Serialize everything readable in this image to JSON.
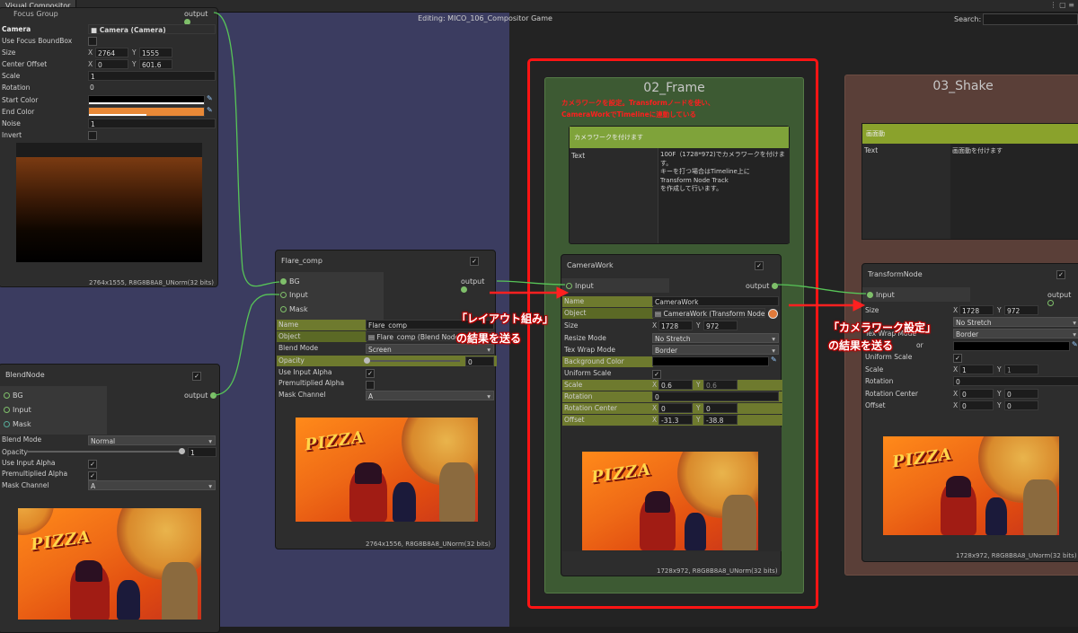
{
  "window": {
    "tab_title": "Visual Compositor",
    "editing_label": "Editing: MICO_106_Compositor Game",
    "search_label": "Search:",
    "search_value": ""
  },
  "focus_node": {
    "title": "Focus Group",
    "output_label": "output",
    "camera_label": "Camera",
    "camera_value": "Camera (Camera)",
    "use_focus_label": "Use Focus BoundBox",
    "size_label": "Size",
    "size_x": "2764",
    "size_y": "1555",
    "center_label": "Center Offset",
    "center_x": "0",
    "center_y": "601.6",
    "scale_label": "Scale",
    "scale_value": "1",
    "rotation_label": "Rotation",
    "rotation_value": "0",
    "start_color_label": "Start Color",
    "end_color_label": "End Color",
    "noise_label": "Noise",
    "noise_value": "1",
    "invert_label": "Invert",
    "footer": "2764x1555, R8G8B8A8_UNorm(32 bits)"
  },
  "blend_node": {
    "title": "BlendNode",
    "bg_label": "BG",
    "input_label": "Input",
    "mask_label": "Mask",
    "output_label": "output",
    "blend_mode_label": "Blend Mode",
    "blend_mode_value": "Normal",
    "opacity_label": "Opacity",
    "opacity_value": "1",
    "use_input_alpha_label": "Use Input Alpha",
    "premult_label": "Premultiplied Alpha",
    "mask_channel_label": "Mask Channel",
    "mask_channel_value": "A"
  },
  "flare_node": {
    "title": "Flare_comp",
    "bg_label": "BG",
    "input_label": "Input",
    "mask_label": "Mask",
    "output_label": "output",
    "name_label": "Name",
    "name_value": "Flare_comp",
    "object_label": "Object",
    "object_value": "Flare_comp (Blend Node P",
    "blend_mode_label": "Blend Mode",
    "blend_mode_value": "Screen",
    "opacity_label": "Opacity",
    "opacity_value": "0",
    "use_input_alpha_label": "Use Input Alpha",
    "premult_label": "Premultiplied Alpha",
    "mask_channel_label": "Mask Channel",
    "mask_channel_value": "A",
    "footer": "2764x1556, R8G8B8A8_UNorm(32 bits)"
  },
  "frame_group": {
    "title": "02_Frame",
    "annotation_line1": "カメラワークを設定。Transformノードを使い、",
    "annotation_line2": "CameraWorkでTimelineに連動している",
    "comment_title": "カメラワークを付けます",
    "comment_text_label": "Text",
    "comment_text_lines": [
      "100F（1728*972)でカメラワークを付けます。",
      "キーを打つ場合はTimeline上に",
      "Transform Node Track",
      "を作成して行います。"
    ]
  },
  "camerawork_node": {
    "title": "CameraWork",
    "input_label": "Input",
    "output_label": "output",
    "name_label": "Name",
    "name_value": "CameraWork",
    "object_label": "Object",
    "object_value": "CameraWork (Transform Node Pr",
    "size_label": "Size",
    "size_x": "1728",
    "size_y": "972",
    "resize_label": "Resize Mode",
    "resize_value": "No Stretch",
    "wrap_label": "Tex Wrap Mode",
    "wrap_value": "Border",
    "bgcolor_label": "Background Color",
    "uniform_label": "Uniform Scale",
    "scale_label": "Scale",
    "scale_x": "0.6",
    "scale_y": "0.6",
    "rotation_label": "Rotation",
    "rotation_value": "0",
    "rotcenter_label": "Rotation Center",
    "rotcenter_x": "0",
    "rotcenter_y": "0",
    "offset_label": "Offset",
    "offset_x": "-31.3",
    "offset_y": "-38.8",
    "footer": "1728x972, R8G8B8A8_UNorm(32 bits)"
  },
  "shake_group": {
    "title": "03_Shake",
    "comment_title": "画面動",
    "comment_text_label": "Text",
    "comment_text": "画面動を付けます"
  },
  "transform_node": {
    "title": "TransformNode",
    "input_label": "Input",
    "output_label": "output",
    "size_label": "Size",
    "size_x": "1728",
    "size_y": "972",
    "resize_value": "No Stretch",
    "wrap_label": "Tex Wrap Mode",
    "wrap_value": "Border",
    "bgcolor_label_partial": "or",
    "uniform_label": "Uniform Scale",
    "scale_label": "Scale",
    "scale_x": "1",
    "scale_y": "1",
    "rotation_label": "Rotation",
    "rotation_value": "0",
    "rotcenter_label": "Rotation Center",
    "rotcenter_x": "0",
    "rotcenter_y": "0",
    "offset_label": "Offset",
    "offset_x": "0",
    "offset_y": "0",
    "footer": "1728x972, R8G8B8A8_UNorm(32 bits)"
  },
  "annotations": {
    "layout_callout_line1": "「レイアウト組み」",
    "layout_callout_line2": "の結果を送る",
    "camera_callout_line1": "「カメラワーク設定」",
    "camera_callout_line2": "の結果を送る"
  },
  "preview": {
    "pizza_text": "PIZZA"
  },
  "colors": {
    "wire": "#57c457",
    "highlight": "#ff1414",
    "frame_group": "#3d5a33",
    "shake_group": "#5a3f38",
    "canvas_blue": "#3b3c60"
  }
}
